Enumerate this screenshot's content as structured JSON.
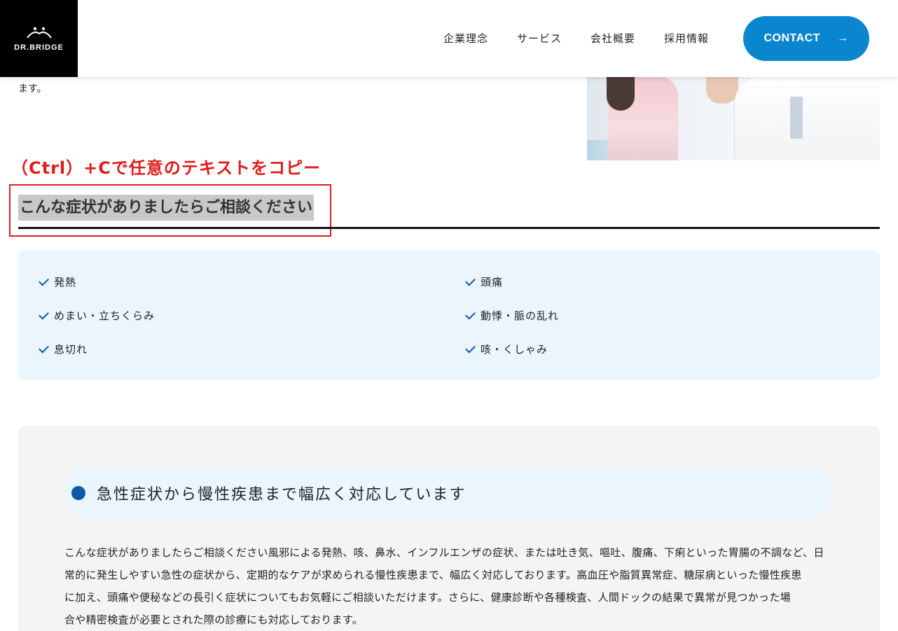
{
  "header": {
    "logo_text": "DR.BRIDGE",
    "nav": [
      "企業理念",
      "サービス",
      "会社概要",
      "採用情報"
    ],
    "contact_label": "CONTACT",
    "contact_arrow": "→",
    "accent_color": "#0a86cf"
  },
  "intro": {
    "cut_text": "ます。"
  },
  "annotation": {
    "copy_note": "（Ctrl）+Cで任意のテキストをコピー",
    "note_color": "#e21b1b"
  },
  "section": {
    "title": "こんな症状がありましたらご相談ください"
  },
  "symptoms": [
    "発熱",
    "頭痛",
    "めまい・立ちくらみ",
    "動悸・脈の乱れ",
    "息切れ",
    "咳・くしゃみ"
  ],
  "feature": {
    "heading": "急性症状から慢性疾患まで幅広く対応しています",
    "lines": [
      "こんな症状がありましたらご相談ください風邪による発熱、咳、鼻水、インフルエンザの症状、または吐き気、嘔吐、腹痛、下痢といった胃腸の不調など、日",
      "常的に発生しやすい急性の症状から、定期的なケアが求められる慢性疾患まで、幅広く対応しております。高血圧や脂質異常症、糖尿病といった慢性疾患",
      "に加え、頭痛や便秘などの長引く症状についてもお気軽にご相談いただけます。さらに、健康診断や各種検査、人間ドックの結果で異常が見つかった場",
      "合や精密検査が必要とされた際の診療にも対応しております。"
    ]
  }
}
